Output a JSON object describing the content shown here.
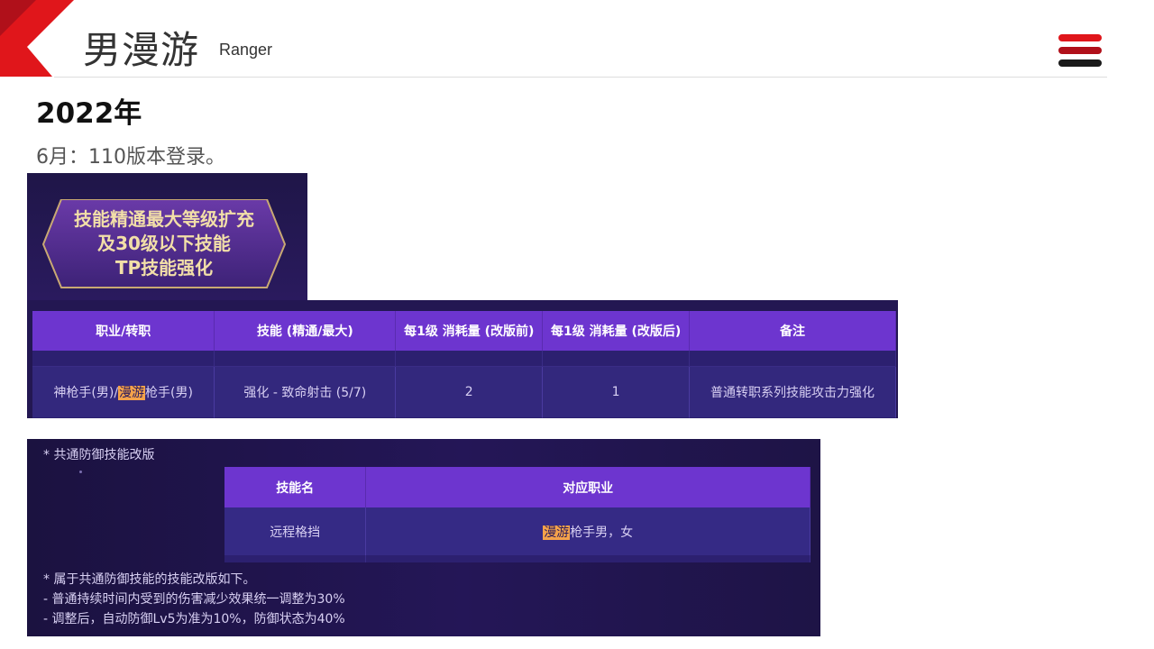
{
  "header": {
    "title": "男漫游",
    "subtitle": "Ranger",
    "colors": {
      "accent_red": "#e0161b",
      "dark_red": "#b0101a",
      "bar_dark": "#1a1a1a"
    },
    "menu_icon": "hamburger-menu-icon"
  },
  "content": {
    "year": "2022年",
    "note": "6月：110版本登录。"
  },
  "banner": {
    "lines": [
      "技能精通最大等级扩充",
      "及30级以下技能",
      "TP技能强化"
    ]
  },
  "skill_table": {
    "headers": [
      "职业/转职",
      "技能 (精通/最大)",
      "每1级 消耗量 (改版前)",
      "每1级 消耗量 (改版后)",
      "备注"
    ],
    "row": {
      "job_prefix": "神枪手(男)/",
      "job_highlight": "漫游",
      "job_suffix": "枪手(男)",
      "skill": "强化 - 致命射击 (5/7)",
      "cost_before": "2",
      "cost_after": "1",
      "remark": "普通转职系列技能攻击力强化"
    }
  },
  "defense": {
    "title": "* 共通防御技能改版",
    "headers": [
      "技能名",
      "对应职业"
    ],
    "row": {
      "skill": "远程格挡",
      "job_highlight": "漫游",
      "job_suffix": "枪手男，女"
    },
    "notes": [
      "* 属于共通防御技能的技能改版如下。",
      "- 普通持续时间内受到的伤害减少效果统一调整为30%",
      "- 调整后，自动防御Lv5为准为10%，防御状态为40%"
    ]
  }
}
